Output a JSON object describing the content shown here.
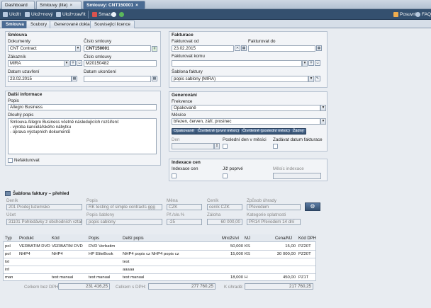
{
  "tabs": {
    "dashboard": "Dashboard",
    "smlouvy_list": "Smlouvy (lite)",
    "smlouvy_active": "Smlouvy: CNT150001"
  },
  "toolbar": {
    "save": "Uložit",
    "save_new": "Ulož+nový",
    "save_close": "Ulož+zavřít",
    "delete": "Smazat",
    "assistant": "Posuvník",
    "faq": "FAQ"
  },
  "subtabs": [
    "Smlouva",
    "Soubory",
    "Generované doklady",
    "Související licence"
  ],
  "smlouva": {
    "title": "Smlouva",
    "dokumenty_label": "Dokumenty",
    "dokumenty_value": "CNT Contract",
    "cislo_smlouvy_label": "Číslo smlouvy",
    "cislo_smlouvy_value": "CNT150001",
    "zakaznik_label": "Zákazník",
    "zakaznik_value": "MIRA",
    "cislo_smlouvy2_label": "Číslo smlouvy",
    "cislo_smlouvy2_value": "M20150482",
    "datum_uzavreni_label": "Datum uzavření",
    "datum_uzavreni_value": "23.02.2015",
    "datum_ukonceni_label": "Datum ukončení",
    "datum_ukonceni_value": ""
  },
  "dalsi": {
    "title": "Další informace",
    "popis_label": "Popis",
    "popis_value": "Allegro Business",
    "dlouhy_popis_label": "Dlouhý popis",
    "dlouhy_popis_value": "Smlouva Allegro Business včetně následujících rozšíření:\n- výroba kancelářského nábytku\n- úprava výstupních dokumentů",
    "nefakturovat_label": "Nefakturovat"
  },
  "fakturace": {
    "title": "Fakturace",
    "od_label": "Fakturovat od",
    "od_value": "23.02.2015",
    "do_label": "Fakturovat do",
    "do_value": "",
    "komu_label": "Fakturovat komu",
    "komu_value": "",
    "sablona_label": "Šablona faktury",
    "sablona_value": "popis sablony (MIRA)"
  },
  "generovani": {
    "title": "Generování",
    "frekvence_label": "Frekvence",
    "frekvence_value": "Opakovaně",
    "mesice_label": "Měsíce",
    "mesice_value": "březen, červen, září, prosinec",
    "btn_opakovane": "Opakovaně",
    "btn_prvni": "Čtvrtletně (první měsíc)",
    "btn_posledni": "Čtvrtletně (poslední měsíc)",
    "btn_zadny": "Žádný",
    "den_label": "Den",
    "posledni_den_label": "Poslední den v měsíci",
    "zadavat_label": "Zadávat datum fakturace"
  },
  "indexace": {
    "title": "Indexace cen",
    "indexace_label": "Indexace cen",
    "jiz_poprve_label": "Již poprvé",
    "mesic_label": "Měsíc indexace"
  },
  "sablona": {
    "title": "Šablona faktury – přehled",
    "denik_label": "Deník",
    "denik_value": "201 Prodej tuzemsko",
    "popis_label": "Popis",
    "popis_value": "RK testing of simple contracts ggg",
    "mena_label": "Měna",
    "mena_value": "CZK",
    "cenik_label": "Ceník",
    "cenik_value": "ceník CZK",
    "zpusob_label": "Způsob úhrady",
    "zpusob_value": "Převodem",
    "ucet_label": "Účet",
    "ucet_value": "31101 Pohledávky z obchodních vztah",
    "popis_sablony_label": "Popis šablony",
    "popis_sablony_value": "popis sablony",
    "pri_label": "Př./sle.%",
    "pri_value": "-25",
    "zaloha_label": "Záloha",
    "zaloha_value": "60 000,00",
    "kategorie_label": "Kategorie splatnosti",
    "kategorie_value": "PR14 Převodem 14 dní"
  },
  "items": {
    "headers": [
      "Typ",
      "Produkt",
      "Kód",
      "Popis",
      "Delší popis",
      "Množství",
      "MJ",
      "Cena/MJ",
      "Kód DPH"
    ],
    "rows": [
      [
        "pol",
        "VERBATIM DVD",
        "VERBATIM DVD",
        "DVD Verbatim",
        "",
        "50,000",
        "KS",
        "15,00",
        "PZ20T"
      ],
      [
        "pol",
        "NHP4",
        "NHP4",
        "HP EliteBook",
        "NHP4 popis cz NHP4 popis cz",
        "15,000",
        "KS",
        "30 000,00",
        "PZ20T"
      ],
      [
        "txt",
        "",
        "",
        "",
        "test",
        "",
        "",
        "",
        ""
      ],
      [
        "inf",
        "",
        "",
        "",
        "aaaaa",
        "",
        "",
        "",
        ""
      ],
      [
        "man",
        "",
        "test manual",
        "test manual",
        "test manual",
        "18,000",
        "H",
        "450,00",
        "PZ1T"
      ]
    ]
  },
  "totals": {
    "bez_dph_label": "Celkem bez DPH:",
    "bez_dph_value": "231 416,25",
    "s_dph_label": "Celkem s DPH:",
    "s_dph_value": "277 760,25",
    "k_uhrade_label": "K úhradě:",
    "k_uhrade_value": "217 760,25"
  },
  "colors": {
    "accent": "#4a6b93",
    "toolbar": "#34506f"
  }
}
